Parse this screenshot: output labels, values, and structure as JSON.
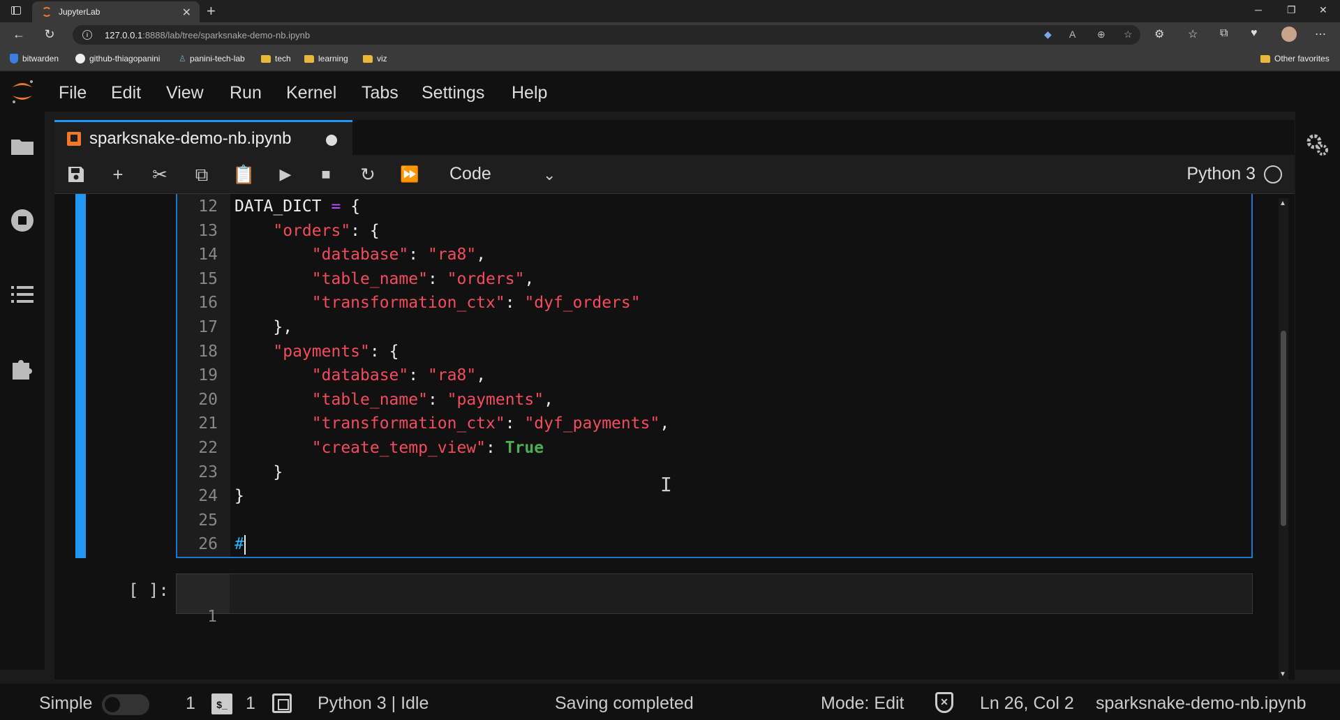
{
  "browser": {
    "tab_title": "JupyterLab",
    "url_host": "127.0.0.1",
    "url_rest": ":8888/lab/tree/sparksnake-demo-nb.ipynb",
    "bookmarks": [
      "bitwarden",
      "github-thiagopanini",
      "panini-tech-lab",
      "tech",
      "learning",
      "viz"
    ],
    "other_favorites": "Other favorites"
  },
  "menu": [
    "File",
    "Edit",
    "View",
    "Run",
    "Kernel",
    "Tabs",
    "Settings",
    "Help"
  ],
  "notebook": {
    "tab_title": "sparksnake-demo-nb.ipynb",
    "cell_type": "Code",
    "kernel": "Python 3"
  },
  "cell1": {
    "lines": [
      {
        "n": "12",
        "parts": [
          [
            "code",
            "DATA_DICT "
          ],
          [
            "op",
            "="
          ],
          [
            "code",
            " {"
          ]
        ]
      },
      {
        "n": "13",
        "parts": [
          [
            "code",
            "    "
          ],
          [
            "str",
            "\"orders\""
          ],
          [
            "code",
            ": {"
          ]
        ]
      },
      {
        "n": "14",
        "parts": [
          [
            "code",
            "        "
          ],
          [
            "str",
            "\"database\""
          ],
          [
            "code",
            ": "
          ],
          [
            "str",
            "\"ra8\""
          ],
          [
            "code",
            ","
          ]
        ]
      },
      {
        "n": "15",
        "parts": [
          [
            "code",
            "        "
          ],
          [
            "str",
            "\"table_name\""
          ],
          [
            "code",
            ": "
          ],
          [
            "str",
            "\"orders\""
          ],
          [
            "code",
            ","
          ]
        ]
      },
      {
        "n": "16",
        "parts": [
          [
            "code",
            "        "
          ],
          [
            "str",
            "\"transformation_ctx\""
          ],
          [
            "code",
            ": "
          ],
          [
            "str",
            "\"dyf_orders\""
          ]
        ]
      },
      {
        "n": "17",
        "parts": [
          [
            "code",
            "    },"
          ]
        ]
      },
      {
        "n": "18",
        "parts": [
          [
            "code",
            "    "
          ],
          [
            "str",
            "\"payments\""
          ],
          [
            "code",
            ": {"
          ]
        ]
      },
      {
        "n": "19",
        "parts": [
          [
            "code",
            "        "
          ],
          [
            "str",
            "\"database\""
          ],
          [
            "code",
            ": "
          ],
          [
            "str",
            "\"ra8\""
          ],
          [
            "code",
            ","
          ]
        ]
      },
      {
        "n": "20",
        "parts": [
          [
            "code",
            "        "
          ],
          [
            "str",
            "\"table_name\""
          ],
          [
            "code",
            ": "
          ],
          [
            "str",
            "\"payments\""
          ],
          [
            "code",
            ","
          ]
        ]
      },
      {
        "n": "21",
        "parts": [
          [
            "code",
            "        "
          ],
          [
            "str",
            "\"transformation_ctx\""
          ],
          [
            "code",
            ": "
          ],
          [
            "str",
            "\"dyf_payments\""
          ],
          [
            "code",
            ","
          ]
        ]
      },
      {
        "n": "22",
        "parts": [
          [
            "code",
            "        "
          ],
          [
            "str",
            "\"create_temp_view\""
          ],
          [
            "code",
            ": "
          ],
          [
            "kw",
            "True"
          ]
        ]
      },
      {
        "n": "23",
        "parts": [
          [
            "code",
            "    }"
          ]
        ]
      },
      {
        "n": "24",
        "parts": [
          [
            "code",
            "}"
          ]
        ]
      },
      {
        "n": "25",
        "parts": []
      },
      {
        "n": "26",
        "parts": [
          [
            "cmt",
            "#"
          ]
        ]
      }
    ]
  },
  "cell2": {
    "prompt": "[ ]:",
    "line_number": "1"
  },
  "status": {
    "mode_label": "Simple",
    "terminals_count": "1",
    "kernels_count": "1",
    "kernel_status": "Python 3 | Idle",
    "save_status": "Saving completed",
    "mode": "Mode: Edit",
    "cursor": "Ln 26, Col 2",
    "file": "sparksnake-demo-nb.ipynb"
  },
  "colors": {
    "accent": "#2196f3",
    "jupyter_orange": "#f37726",
    "string": "#f44c5c",
    "keyword": "#4caf50",
    "operator": "#b84dff"
  }
}
